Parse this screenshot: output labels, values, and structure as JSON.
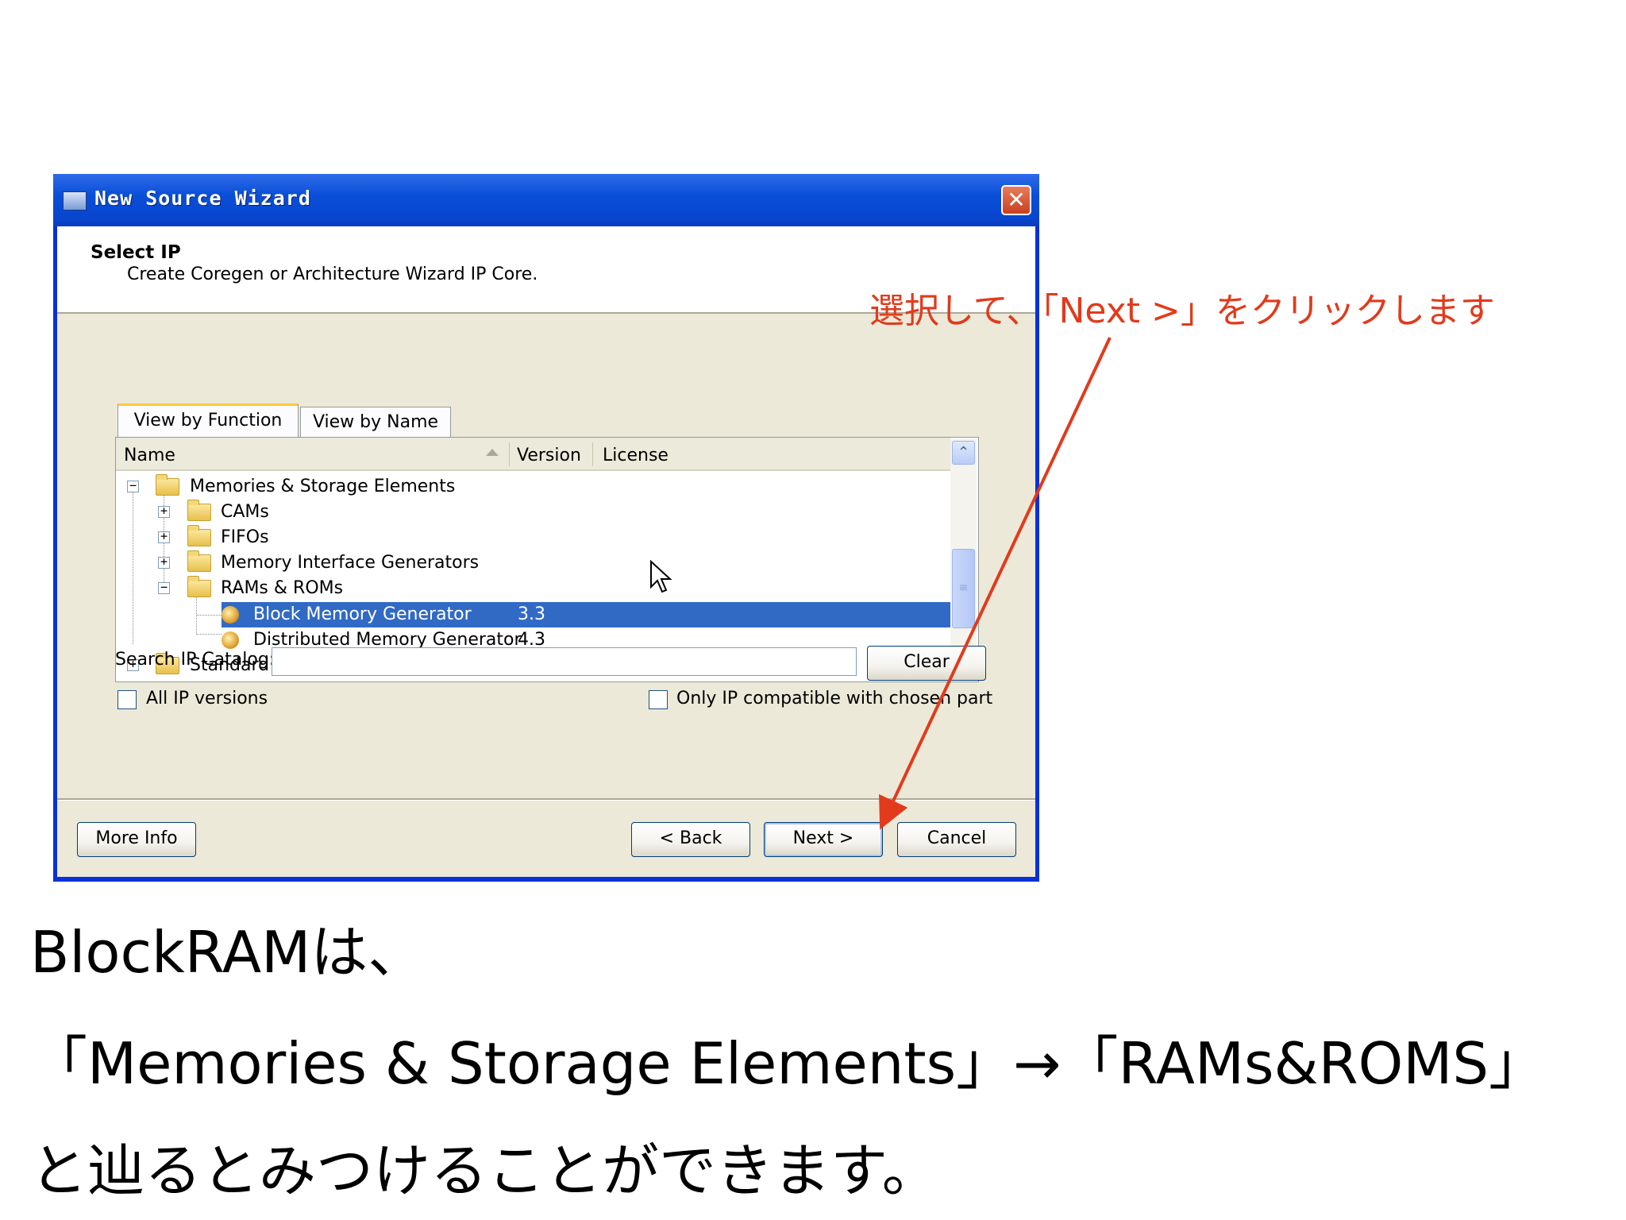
{
  "window": {
    "title": "New Source Wizard",
    "close_glyph": "✕"
  },
  "header": {
    "title": "Select IP",
    "subtitle": "Create Coregen or Architecture Wizard IP Core."
  },
  "tabs": [
    {
      "label": "View by Function",
      "active": true
    },
    {
      "label": "View by Name",
      "active": false
    }
  ],
  "columns": [
    "Name",
    "Version",
    "License"
  ],
  "tree": [
    {
      "label": "Memories & Storage Elements",
      "expander": "⊟",
      "icon": "folder-open-icon"
    },
    {
      "label": "CAMs",
      "expander": "⊞",
      "icon": "folder-icon"
    },
    {
      "label": "FIFOs",
      "expander": "⊞",
      "icon": "folder-icon"
    },
    {
      "label": "Memory Interface Generators",
      "expander": "⊞",
      "icon": "folder-icon"
    },
    {
      "label": "RAMs & ROMs",
      "expander": "⊟",
      "icon": "folder-open-icon"
    },
    {
      "label": "Block Memory Generator",
      "version": "3.3",
      "icon": "ip-core-icon",
      "selected": true
    },
    {
      "label": "Distributed Memory Generator",
      "version": "4.3",
      "icon": "ip-core-icon"
    },
    {
      "label": "Standard Bus Interfaces",
      "expander": "⊞",
      "icon": "folder-icon"
    }
  ],
  "search": {
    "label": "Search IP Catalog:",
    "value": "",
    "clear_label": "Clear"
  },
  "options": {
    "all_versions": "All IP versions",
    "only_compatible": "Only IP compatible with chosen part"
  },
  "buttons": {
    "more_info": "More Info",
    "back": "< Back",
    "next": "Next >",
    "cancel": "Cancel"
  },
  "annotation": "選択して、「Next >」をクリックします",
  "caption": {
    "line1": "BlockRAMは、",
    "line2": "「Memories & Storage Elements」→「RAMs&ROMS」",
    "line3": "と辿るとみつけることができます。"
  },
  "colors": {
    "annotation": "#e23a1c",
    "selection": "#316ac5",
    "titlebar": "#0a4fd8"
  }
}
